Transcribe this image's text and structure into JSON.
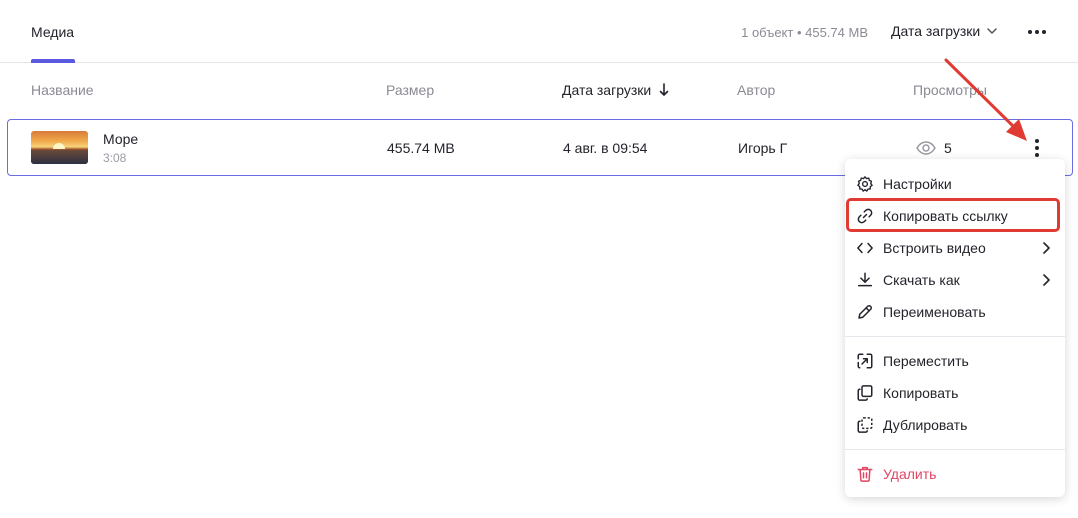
{
  "header": {
    "tab_label": "Медиа",
    "object_count": "1 объект • 455.74 MB",
    "sort_label": "Дата загрузки"
  },
  "columns": {
    "name": "Название",
    "size": "Размер",
    "date": "Дата загрузки",
    "author": "Автор",
    "views": "Просмотры"
  },
  "rows": [
    {
      "title": "Море",
      "duration": "3:08",
      "size": "455.74 MB",
      "date": "4 авг. в 09:54",
      "author": "Игорь Г",
      "views": "5"
    }
  ],
  "menu": {
    "items": [
      {
        "label": "Настройки",
        "icon": "gear-icon"
      },
      {
        "label": "Копировать ссылку",
        "icon": "link-icon"
      },
      {
        "label": "Встроить видео",
        "icon": "code-icon",
        "submenu": true
      },
      {
        "label": "Скачать как",
        "icon": "download-icon",
        "submenu": true
      },
      {
        "label": "Переименовать",
        "icon": "pencil-icon"
      },
      {
        "label": "Переместить",
        "icon": "move-icon"
      },
      {
        "label": "Копировать",
        "icon": "copy-icon"
      },
      {
        "label": "Дублировать",
        "icon": "duplicate-icon"
      },
      {
        "label": "Удалить",
        "icon": "trash-icon"
      }
    ]
  },
  "colors": {
    "accent": "#5a59e0",
    "row_border": "#6b6be6",
    "danger": "#e24663",
    "annotation": "#e03b32"
  }
}
